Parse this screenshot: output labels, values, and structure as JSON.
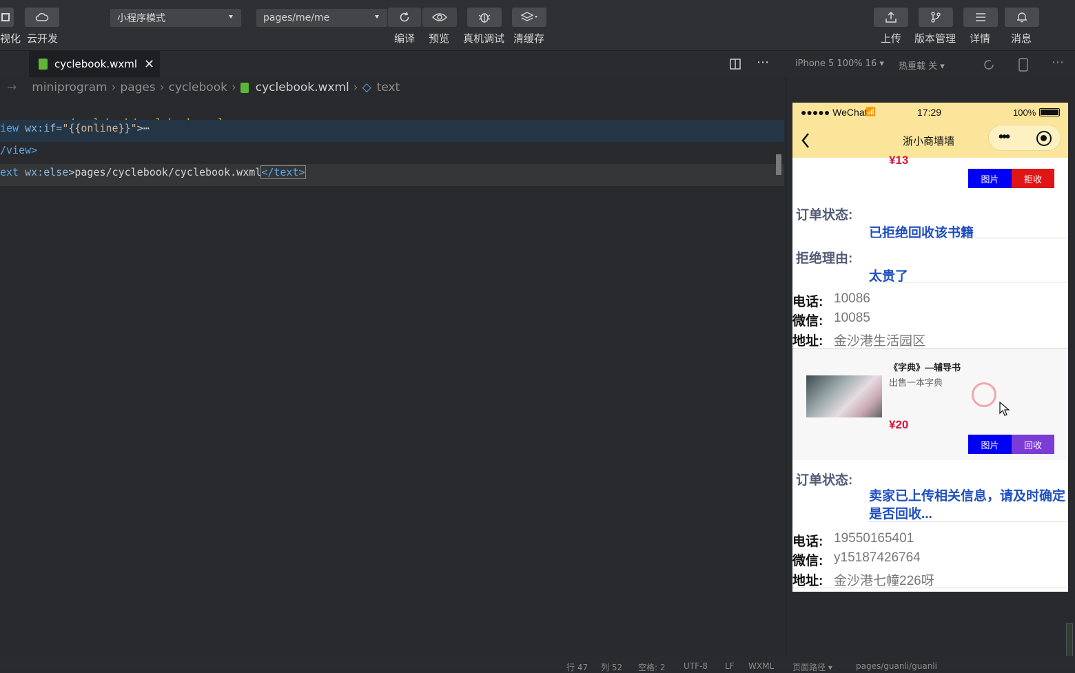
{
  "toolbar": {
    "left_partial_label": "视化",
    "cloud_label": "云开发",
    "mode_select": "小程序模式",
    "page_select": "pages/me/me",
    "compile_label": "编译",
    "preview_label": "预览",
    "debug_label": "真机调试",
    "clear_label": "清缓存",
    "upload_label": "上传",
    "version_label": "版本管理",
    "details_label": "详情",
    "messages_label": "消息"
  },
  "editor": {
    "tab_label": "cyclebook.wxml",
    "breadcrumb": [
      "miniprogram",
      "pages",
      "cyclebook",
      "cyclebook.wxml",
      "text"
    ],
    "lines": {
      "l1": "--pages/cyclebook/cyclebook.wxml-->",
      "l2_tag": "iew",
      "l2_attr": " wx:if=",
      "l2_str": "\"{{online}}\"",
      "l2_end": ">⋯",
      "l3": "/view>",
      "l4_tag": "ext",
      "l4_attr": " wx:else",
      "l4_text": ">pages/cyclebook/cyclebook.wxml",
      "l4_close": "</text>"
    }
  },
  "simulator": {
    "device": "iPhone 5 100% 16 ▾",
    "hot_reload": "热重载 关 ▾",
    "status_left": "●●●●● WeChat",
    "status_time": "17:29",
    "status_battery": "100%",
    "nav_title": "浙小商墙墙",
    "order1": {
      "price": "¥13",
      "btn_image": "图片",
      "btn_action": "拒收",
      "status_label": "订单状态:",
      "status_value": "已拒绝回收该书籍",
      "reason_label": "拒绝理由:",
      "reason_value": "太贵了",
      "phone_k": "电话:",
      "phone_v": "10086",
      "wechat_k": "微信:",
      "wechat_v": "10085",
      "addr_k": "地址:",
      "addr_v": "金沙港生活园区"
    },
    "order2": {
      "title": "《字典》—辅导书",
      "desc": "出售一本字典",
      "price": "¥20",
      "btn_image": "图片",
      "btn_action": "回收",
      "status_label": "订单状态:",
      "status_value": "卖家已上传相关信息，请及时确定是否回收...",
      "phone_k": "电话:",
      "phone_v": "19550165401",
      "wechat_k": "微信:",
      "wechat_v": "y15187426764",
      "addr_k": "地址:",
      "addr_v": "金沙港七幢226呀"
    }
  },
  "statusbar": {
    "row": "行 47",
    "col": "列 52",
    "spaces": "空格: 2",
    "encoding": "UTF-8",
    "eol": "LF",
    "lang": "WXML",
    "page_path_label": "页面路径 ▾",
    "page_path": "pages/guanli/guanli"
  },
  "colors": {
    "accent_blue_button": "#0000f5",
    "reject_red_button": "#e01515",
    "accept_purple_button": "#7b3bd6",
    "navbar_yellow": "#fbe59a"
  }
}
